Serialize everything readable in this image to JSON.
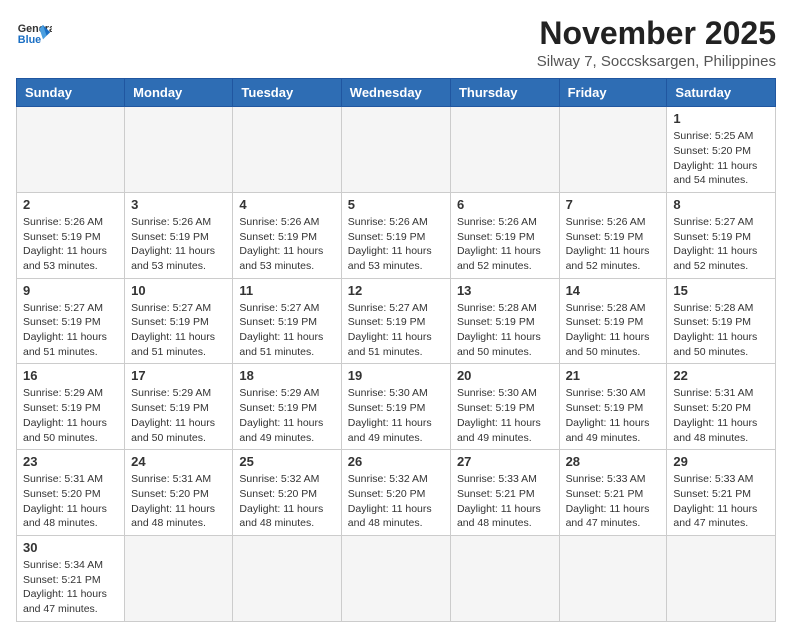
{
  "header": {
    "logo_line1": "General",
    "logo_line2": "Blue",
    "month_title": "November 2025",
    "subtitle": "Silway 7, Soccsksargen, Philippines"
  },
  "days_of_week": [
    "Sunday",
    "Monday",
    "Tuesday",
    "Wednesday",
    "Thursday",
    "Friday",
    "Saturday"
  ],
  "weeks": [
    [
      {
        "day": "",
        "info": ""
      },
      {
        "day": "",
        "info": ""
      },
      {
        "day": "",
        "info": ""
      },
      {
        "day": "",
        "info": ""
      },
      {
        "day": "",
        "info": ""
      },
      {
        "day": "",
        "info": ""
      },
      {
        "day": "1",
        "info": "Sunrise: 5:25 AM\nSunset: 5:20 PM\nDaylight: 11 hours\nand 54 minutes."
      }
    ],
    [
      {
        "day": "2",
        "info": "Sunrise: 5:26 AM\nSunset: 5:19 PM\nDaylight: 11 hours\nand 53 minutes."
      },
      {
        "day": "3",
        "info": "Sunrise: 5:26 AM\nSunset: 5:19 PM\nDaylight: 11 hours\nand 53 minutes."
      },
      {
        "day": "4",
        "info": "Sunrise: 5:26 AM\nSunset: 5:19 PM\nDaylight: 11 hours\nand 53 minutes."
      },
      {
        "day": "5",
        "info": "Sunrise: 5:26 AM\nSunset: 5:19 PM\nDaylight: 11 hours\nand 53 minutes."
      },
      {
        "day": "6",
        "info": "Sunrise: 5:26 AM\nSunset: 5:19 PM\nDaylight: 11 hours\nand 52 minutes."
      },
      {
        "day": "7",
        "info": "Sunrise: 5:26 AM\nSunset: 5:19 PM\nDaylight: 11 hours\nand 52 minutes."
      },
      {
        "day": "8",
        "info": "Sunrise: 5:27 AM\nSunset: 5:19 PM\nDaylight: 11 hours\nand 52 minutes."
      }
    ],
    [
      {
        "day": "9",
        "info": "Sunrise: 5:27 AM\nSunset: 5:19 PM\nDaylight: 11 hours\nand 51 minutes."
      },
      {
        "day": "10",
        "info": "Sunrise: 5:27 AM\nSunset: 5:19 PM\nDaylight: 11 hours\nand 51 minutes."
      },
      {
        "day": "11",
        "info": "Sunrise: 5:27 AM\nSunset: 5:19 PM\nDaylight: 11 hours\nand 51 minutes."
      },
      {
        "day": "12",
        "info": "Sunrise: 5:27 AM\nSunset: 5:19 PM\nDaylight: 11 hours\nand 51 minutes."
      },
      {
        "day": "13",
        "info": "Sunrise: 5:28 AM\nSunset: 5:19 PM\nDaylight: 11 hours\nand 50 minutes."
      },
      {
        "day": "14",
        "info": "Sunrise: 5:28 AM\nSunset: 5:19 PM\nDaylight: 11 hours\nand 50 minutes."
      },
      {
        "day": "15",
        "info": "Sunrise: 5:28 AM\nSunset: 5:19 PM\nDaylight: 11 hours\nand 50 minutes."
      }
    ],
    [
      {
        "day": "16",
        "info": "Sunrise: 5:29 AM\nSunset: 5:19 PM\nDaylight: 11 hours\nand 50 minutes."
      },
      {
        "day": "17",
        "info": "Sunrise: 5:29 AM\nSunset: 5:19 PM\nDaylight: 11 hours\nand 50 minutes."
      },
      {
        "day": "18",
        "info": "Sunrise: 5:29 AM\nSunset: 5:19 PM\nDaylight: 11 hours\nand 49 minutes."
      },
      {
        "day": "19",
        "info": "Sunrise: 5:30 AM\nSunset: 5:19 PM\nDaylight: 11 hours\nand 49 minutes."
      },
      {
        "day": "20",
        "info": "Sunrise: 5:30 AM\nSunset: 5:19 PM\nDaylight: 11 hours\nand 49 minutes."
      },
      {
        "day": "21",
        "info": "Sunrise: 5:30 AM\nSunset: 5:19 PM\nDaylight: 11 hours\nand 49 minutes."
      },
      {
        "day": "22",
        "info": "Sunrise: 5:31 AM\nSunset: 5:20 PM\nDaylight: 11 hours\nand 48 minutes."
      }
    ],
    [
      {
        "day": "23",
        "info": "Sunrise: 5:31 AM\nSunset: 5:20 PM\nDaylight: 11 hours\nand 48 minutes."
      },
      {
        "day": "24",
        "info": "Sunrise: 5:31 AM\nSunset: 5:20 PM\nDaylight: 11 hours\nand 48 minutes."
      },
      {
        "day": "25",
        "info": "Sunrise: 5:32 AM\nSunset: 5:20 PM\nDaylight: 11 hours\nand 48 minutes."
      },
      {
        "day": "26",
        "info": "Sunrise: 5:32 AM\nSunset: 5:20 PM\nDaylight: 11 hours\nand 48 minutes."
      },
      {
        "day": "27",
        "info": "Sunrise: 5:33 AM\nSunset: 5:21 PM\nDaylight: 11 hours\nand 48 minutes."
      },
      {
        "day": "28",
        "info": "Sunrise: 5:33 AM\nSunset: 5:21 PM\nDaylight: 11 hours\nand 47 minutes."
      },
      {
        "day": "29",
        "info": "Sunrise: 5:33 AM\nSunset: 5:21 PM\nDaylight: 11 hours\nand 47 minutes."
      }
    ],
    [
      {
        "day": "30",
        "info": "Sunrise: 5:34 AM\nSunset: 5:21 PM\nDaylight: 11 hours\nand 47 minutes."
      },
      {
        "day": "",
        "info": ""
      },
      {
        "day": "",
        "info": ""
      },
      {
        "day": "",
        "info": ""
      },
      {
        "day": "",
        "info": ""
      },
      {
        "day": "",
        "info": ""
      },
      {
        "day": "",
        "info": ""
      }
    ]
  ]
}
